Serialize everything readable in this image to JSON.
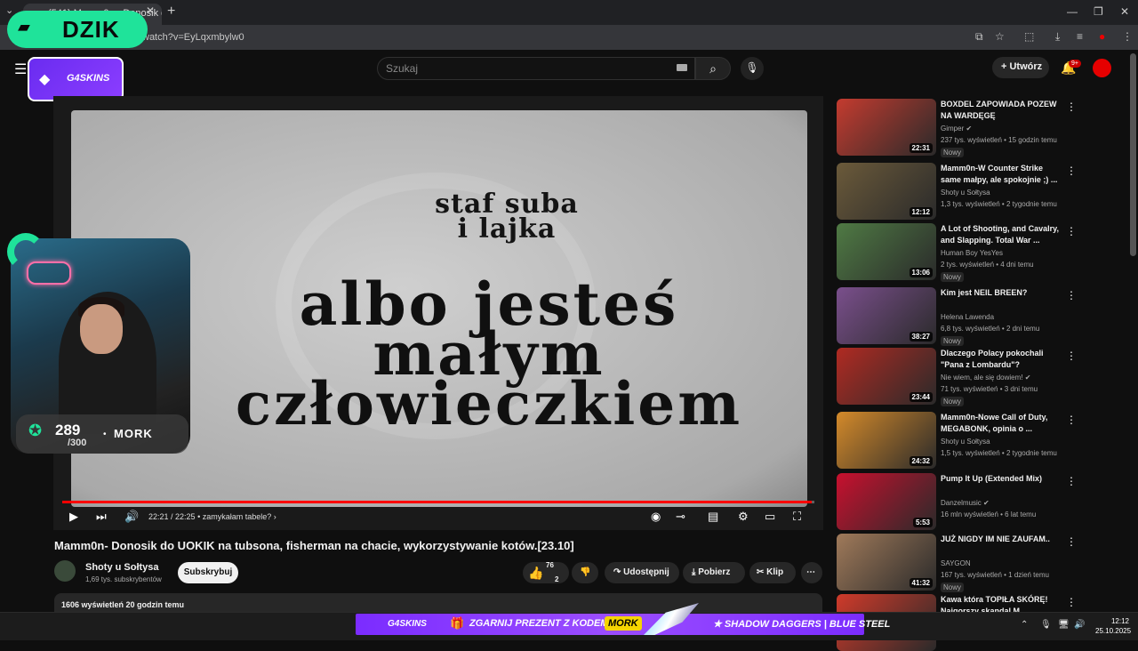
{
  "browser": {
    "tab_title": "(541) Mamm0n - Donosik do U...",
    "url": "watch?v=EyLqxmbylw0"
  },
  "overlay": {
    "brand": "DZIK",
    "score": "289",
    "score_total": "/300",
    "streamer": "MORK"
  },
  "header": {
    "sponsor_logo": "G4SKINS",
    "search_placeholder": "Szukaj",
    "create_label": "Utwórz",
    "notif_badge": "9+"
  },
  "player": {
    "line_small_1": "staf suba",
    "line_small_2": "i lajka",
    "line_big_1": "albo jesteś",
    "line_big_2": "małym",
    "line_big_3": "człowieczkiem",
    "time": "22:21 / 22:25",
    "chapter": "• zamykałam tabele? ›",
    "progress": 0.997
  },
  "video": {
    "title": "Mamm0n- Donosik do UOKIK na tubsona, fisherman na chacie, wykorzystywanie kotów.[23.10]",
    "channel": "Shoty u Sołtysa",
    "subscribers": "1,69 tys. subskrybentów",
    "subscribe_label": "Subskrybuj",
    "likes": "76",
    "likes_2": "2",
    "share_label": "Udostępnij",
    "download_label": "Pobierz",
    "clip_label": "Klip",
    "views_line": "1606 wyświetleń  20 godzin temu"
  },
  "recommendations": [
    {
      "title": "BOXDEL ZAPOWIADA POZEW NA WARDĘGĘ",
      "channel": "Gimper ✔",
      "meta": "237 tys. wyświetleń • 15 godzin temu",
      "badge": "Nowy",
      "duration": "22:31",
      "color": "#c43b2f"
    },
    {
      "title": "Mamm0n-W Counter Strike same małpy, ale spokojnie ;) ...",
      "channel": "Shoty u Sołtysa",
      "meta": "1,3 tys. wyświetleń • 2 tygodnie temu",
      "badge": "",
      "duration": "12:12",
      "color": "#6b5a3a"
    },
    {
      "title": "A Lot of Shooting, and Cavalry, and Slapping. Total War ...",
      "channel": "Human Boy YesYes",
      "meta": "2 tys. wyświetleń • 4 dni temu",
      "badge": "Nowy",
      "duration": "13:06",
      "color": "#4f7a44"
    },
    {
      "title": "Kim jest NEIL BREEN?",
      "channel": "Helena Lawenda",
      "meta": "6,8 tys. wyświetleń • 2 dni temu",
      "badge": "Nowy",
      "duration": "38:27",
      "color": "#7a4f8c"
    },
    {
      "title": "Dlaczego Polacy pokochali \"Pana z Lombardu\"?",
      "channel": "Nie wiem, ale się dowiem! ✔",
      "meta": "71 tys. wyświetleń • 3 dni temu",
      "badge": "Nowy",
      "duration": "23:44",
      "color": "#b02a22"
    },
    {
      "title": "Mamm0n-Nowe Call of Duty, MEGABONK, opinia o ...",
      "channel": "Shoty u Sołtysa",
      "meta": "1,5 tys. wyświetleń • 2 tygodnie temu",
      "badge": "",
      "duration": "24:32",
      "color": "#d48a2a"
    },
    {
      "title": "Pump It Up (Extended Mix)",
      "channel": "Danzelmusic ✔",
      "meta": "16 mln wyświetleń • 6 lat temu",
      "badge": "",
      "duration": "5:53",
      "color": "#c8102e"
    },
    {
      "title": "JUŻ NIGDY IM NIE ZAUFAM..",
      "channel": "SAYGON",
      "meta": "167 tys. wyświetleń • 1 dzień temu",
      "badge": "Nowy",
      "duration": "41:32",
      "color": "#a07a5a"
    },
    {
      "title": "Kawa która TOPIŁA SKÓRĘ! Najgorszy skandal M...",
      "channel": "",
      "meta": "",
      "badge": "",
      "duration": "",
      "color": "#d03a2a"
    }
  ],
  "promo": {
    "logo": "G4SKINS",
    "text": "ZGARNIJ PREZENT Z KODEM",
    "code": "MORK",
    "tail": "★ SHADOW DAGGERS | BLUE STEEL"
  },
  "taskbar": {
    "time": "12:12",
    "date": "25.10.2025"
  }
}
